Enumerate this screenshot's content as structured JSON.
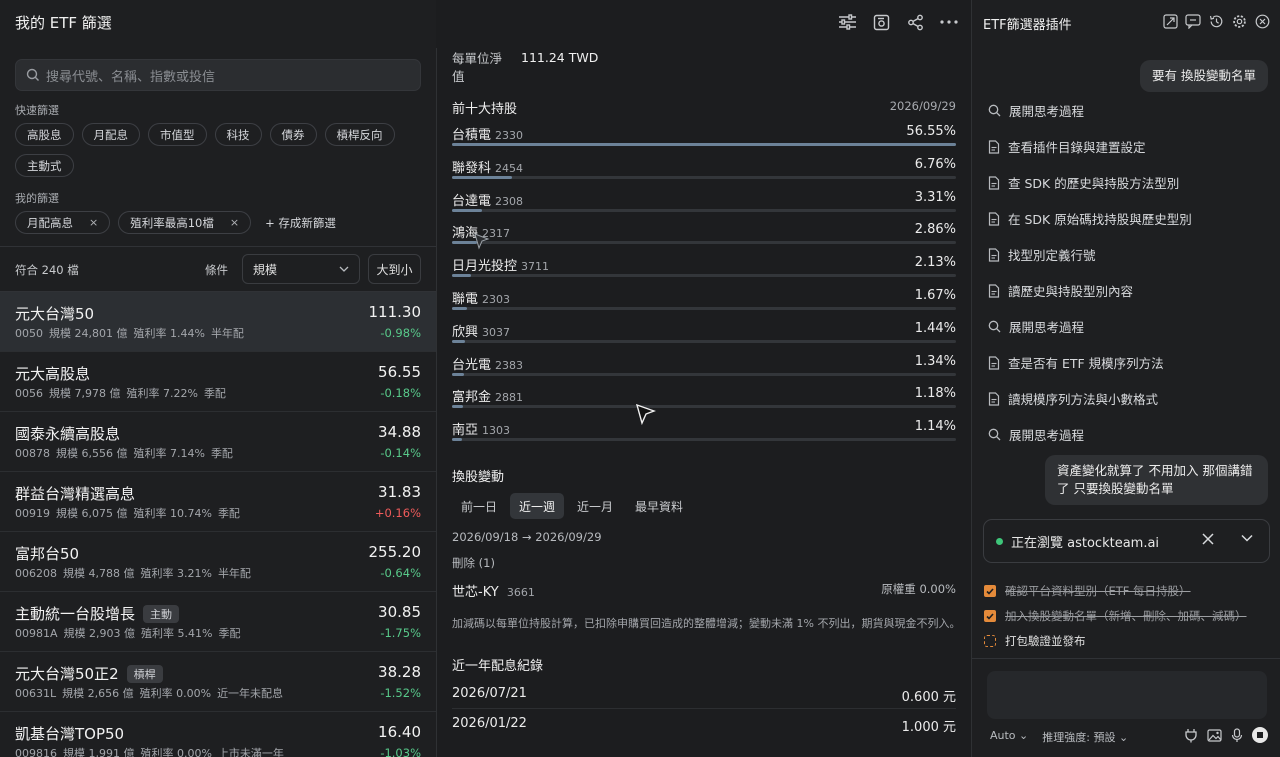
{
  "left": {
    "title": "我的 ETF 篩選",
    "search_placeholder": "搜尋代號、名稱、指數或投信",
    "quick_label": "快速篩選",
    "quick_filters": [
      "高股息",
      "月配息",
      "市值型",
      "科技",
      "債券",
      "槓桿反向",
      "主動式"
    ],
    "my_label": "我的篩選",
    "my_filters": [
      "月配高息",
      "殖利率最高10檔"
    ],
    "remove_glyph": "×",
    "save_filter": "+ 存成新篩選",
    "match_count": "符合 240 檔",
    "condition_label": "條件",
    "sort_field": "規模",
    "sort_order": "大到小",
    "etfs": [
      {
        "name": "元大台灣50",
        "tag": "",
        "code": "0050",
        "scale": "規模 24,801 億",
        "yield": "殖利率 1.44%",
        "freq": "半年配",
        "price": "111.30",
        "change": "-0.98%",
        "dir": "neg"
      },
      {
        "name": "元大高股息",
        "tag": "",
        "code": "0056",
        "scale": "規模 7,978 億",
        "yield": "殖利率 7.22%",
        "freq": "季配",
        "price": "56.55",
        "change": "-0.18%",
        "dir": "neg"
      },
      {
        "name": "國泰永續高股息",
        "tag": "",
        "code": "00878",
        "scale": "規模 6,556 億",
        "yield": "殖利率 7.14%",
        "freq": "季配",
        "price": "34.88",
        "change": "-0.14%",
        "dir": "neg"
      },
      {
        "name": "群益台灣精選高息",
        "tag": "",
        "code": "00919",
        "scale": "規模 6,075 億",
        "yield": "殖利率 10.74%",
        "freq": "季配",
        "price": "31.83",
        "change": "+0.16%",
        "dir": "pos"
      },
      {
        "name": "富邦台50",
        "tag": "",
        "code": "006208",
        "scale": "規模 4,788 億",
        "yield": "殖利率 3.21%",
        "freq": "半年配",
        "price": "255.20",
        "change": "-0.64%",
        "dir": "neg"
      },
      {
        "name": "主動統一台股增長",
        "tag": "主動",
        "code": "00981A",
        "scale": "規模 2,903 億",
        "yield": "殖利率 5.41%",
        "freq": "季配",
        "price": "30.85",
        "change": "-1.75%",
        "dir": "neg"
      },
      {
        "name": "元大台灣50正2",
        "tag": "槓桿",
        "code": "00631L",
        "scale": "規模 2,656 億",
        "yield": "殖利率 0.00%",
        "freq": "近一年未配息",
        "price": "38.28",
        "change": "-1.52%",
        "dir": "neg"
      },
      {
        "name": "凱基台灣TOP50",
        "tag": "",
        "code": "009816",
        "scale": "規模 1,991 億",
        "yield": "殖利率 0.00%",
        "freq": "上市未滿一年",
        "price": "16.40",
        "change": "-1.03%",
        "dir": "neg"
      }
    ]
  },
  "detail": {
    "nav_label": "每單位淨值",
    "nav_value": "111.24 TWD",
    "top10_title": "前十大持股",
    "top10_date": "2026/09/29",
    "holdings": [
      {
        "name": "台積電",
        "code": "2330",
        "pct": "56.55%",
        "value": 56.55
      },
      {
        "name": "聯發科",
        "code": "2454",
        "pct": "6.76%",
        "value": 6.76
      },
      {
        "name": "台達電",
        "code": "2308",
        "pct": "3.31%",
        "value": 3.31
      },
      {
        "name": "鴻海",
        "code": "2317",
        "pct": "2.86%",
        "value": 2.86
      },
      {
        "name": "日月光投控",
        "code": "3711",
        "pct": "2.13%",
        "value": 2.13
      },
      {
        "name": "聯電",
        "code": "2303",
        "pct": "1.67%",
        "value": 1.67
      },
      {
        "name": "欣興",
        "code": "3037",
        "pct": "1.44%",
        "value": 1.44
      },
      {
        "name": "台光電",
        "code": "2383",
        "pct": "1.34%",
        "value": 1.34
      },
      {
        "name": "富邦金",
        "code": "2881",
        "pct": "1.18%",
        "value": 1.18
      },
      {
        "name": "南亞",
        "code": "1303",
        "pct": "1.14%",
        "value": 1.14
      }
    ],
    "changes_title": "換股變動",
    "change_tabs": [
      "前一日",
      "近一週",
      "近一月",
      "最早資料"
    ],
    "active_tab": 1,
    "range": "2026/09/18 → 2026/09/29",
    "removed_label": "刪除 (1)",
    "removed_name": "世芯-KY",
    "removed_code": "3661",
    "removed_weight": "原權重 0.00%",
    "note": "加減碼以每單位持股計算，已扣除申購買回造成的整體增減；變動未滿 1% 不列出，期貨與現金不列入。",
    "dividend_title": "近一年配息紀錄",
    "dividends": [
      {
        "date": "2026/07/21",
        "amount": "0.600 元"
      },
      {
        "date": "2026/01/22",
        "amount": "1.000 元"
      }
    ]
  },
  "assistant": {
    "title": "ETF篩選器插件",
    "user_msg_1": "要有 換股變動名單",
    "steps": [
      {
        "icon": "search",
        "text": "展開思考過程"
      },
      {
        "icon": "file",
        "text": "查看插件目錄與建置設定"
      },
      {
        "icon": "file",
        "text": "查 SDK 的歷史與持股方法型別"
      },
      {
        "icon": "file",
        "text": "在 SDK 原始碼找持股與歷史型別"
      },
      {
        "icon": "file",
        "text": "找型別定義行號"
      },
      {
        "icon": "file",
        "text": "讀歷史與持股型別內容"
      },
      {
        "icon": "search",
        "text": "展開思考過程"
      },
      {
        "icon": "file",
        "text": "查是否有 ETF 規模序列方法"
      },
      {
        "icon": "file",
        "text": "讀規模序列方法與小數格式"
      },
      {
        "icon": "search",
        "text": "展開思考過程"
      }
    ],
    "user_msg_2": "資產變化就算了 不用加入 那個講錯了 只要換股變動名單",
    "browsing": "正在瀏覽 astockteam.ai",
    "todos": [
      {
        "text": "確認平台資料型別（ETF 每日持股）",
        "done": true
      },
      {
        "text": "加入換股變動名單（新增、刪除、加碼、減碼）",
        "done": true
      },
      {
        "text": "打包驗證並發布",
        "done": false
      }
    ],
    "model": "Auto",
    "reasoning": "推理強度: 預設"
  }
}
